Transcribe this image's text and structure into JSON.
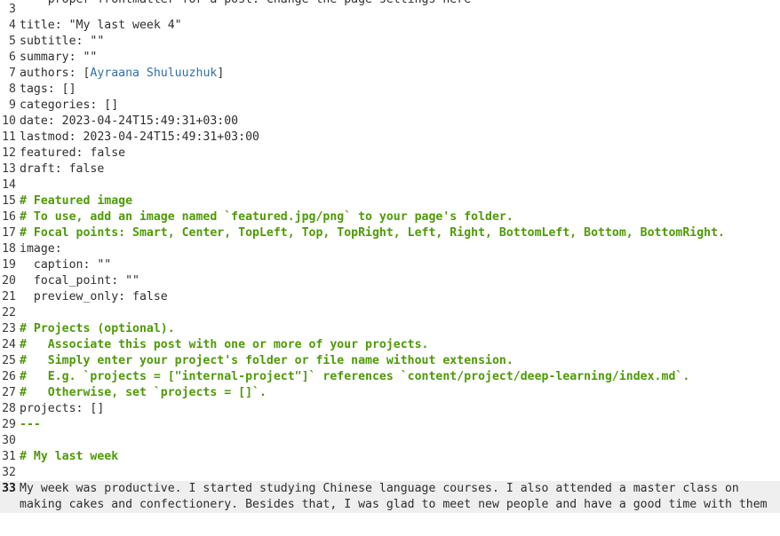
{
  "editor": {
    "top_partial_line": "--- proper frontmatter for a post. Change the page settings here ---",
    "lines": [
      {
        "n": "3",
        "text": ""
      },
      {
        "n": "4",
        "text": "title: \"My last week 4\""
      },
      {
        "n": "5",
        "text": "subtitle: \"\""
      },
      {
        "n": "6",
        "text": "summary: \"\""
      },
      {
        "n": "7",
        "pre": "authors: [",
        "link": "Ayraana Shuluuzhuk",
        "post": "]"
      },
      {
        "n": "8",
        "text": "tags: []"
      },
      {
        "n": "9",
        "text": "categories: []"
      },
      {
        "n": "10",
        "text": "date: 2023-04-24T15:49:31+03:00"
      },
      {
        "n": "11",
        "text": "lastmod: 2023-04-24T15:49:31+03:00"
      },
      {
        "n": "12",
        "text": "featured: false"
      },
      {
        "n": "13",
        "text": "draft: false"
      },
      {
        "n": "14",
        "text": ""
      },
      {
        "n": "15",
        "comment": "# Featured image"
      },
      {
        "n": "16",
        "comment": "# To use, add an image named `featured.jpg/png` to your page's folder."
      },
      {
        "n": "17",
        "comment": "# Focal points: Smart, Center, TopLeft, Top, TopRight, Left, Right, BottomLeft, Bottom, BottomRight."
      },
      {
        "n": "18",
        "text": "image:"
      },
      {
        "n": "19",
        "text": "  caption: \"\""
      },
      {
        "n": "20",
        "text": "  focal_point: \"\""
      },
      {
        "n": "21",
        "text": "  preview_only: false"
      },
      {
        "n": "22",
        "text": ""
      },
      {
        "n": "23",
        "comment": "# Projects (optional)."
      },
      {
        "n": "24",
        "comment": "#   Associate this post with one or more of your projects."
      },
      {
        "n": "25",
        "comment": "#   Simply enter your project's folder or file name without extension."
      },
      {
        "n": "26",
        "comment": "#   E.g. `projects = [\"internal-project\"]` references `content/project/deep-learning/index.md`."
      },
      {
        "n": "27",
        "comment": "#   Otherwise, set `projects = []`."
      },
      {
        "n": "28",
        "text": "projects: []"
      },
      {
        "n": "29",
        "comment": "---"
      },
      {
        "n": "30",
        "text": ""
      },
      {
        "n": "31",
        "comment": "# My last week"
      },
      {
        "n": "32",
        "text": ""
      },
      {
        "n": "33",
        "text": "My week was productive. I started studying Chinese language courses. I also attended a master class on",
        "current": true
      },
      {
        "n": "",
        "text": "making cakes and confectionery. Besides that, I was glad to meet new people and have a good time with them",
        "current": true
      }
    ]
  },
  "colors": {
    "comment": "#4e9a06",
    "link": "#2f6fa8",
    "current_line": "#efefef"
  }
}
